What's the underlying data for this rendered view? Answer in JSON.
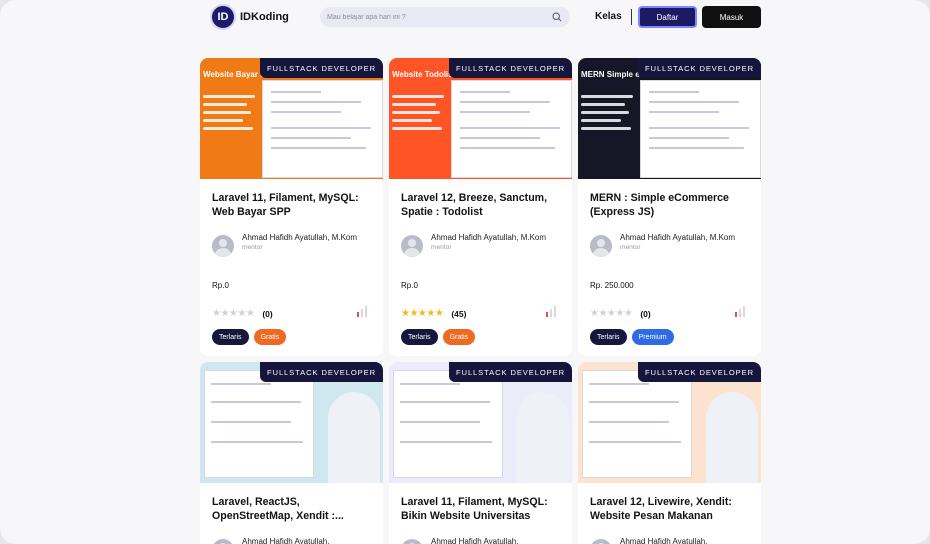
{
  "nav": {
    "brand": "IDKoding",
    "logo_mark": "ID",
    "search_placeholder": "Mau belajar apa hari ini ?",
    "kelas_label": "Kelas",
    "daftar_label": "Daftar",
    "masuk_label": "Masuk"
  },
  "courses": [
    {
      "band": "FULLSTACK DEVELOPER",
      "thumb_title": "Website Bayar SPP",
      "thumb_color": "#f07a15",
      "title": "Laravel 11, Filament, MySQL: Web Bayar SPP",
      "author": "Ahmad Hafidh Ayatullah, M.Kom",
      "role": "mentor",
      "price": "Rp.0",
      "stars": 0,
      "rating_count": "(0)",
      "tags": [
        {
          "label": "Terlaris",
          "style": "dark"
        },
        {
          "label": "Gratis",
          "style": "orange"
        }
      ]
    },
    {
      "band": "FULLSTACK DEVELOPER",
      "thumb_title": "Website Todolist",
      "thumb_color": "#ff5426",
      "title": "Laravel 12, Breeze, Sanctum, Spatie : Todolist",
      "author": "Ahmad Hafidh Ayatullah, M.Kom",
      "role": "mentor",
      "price": "Rp.0",
      "stars": 5,
      "rating_count": "(45)",
      "tags": [
        {
          "label": "Terlaris",
          "style": "dark"
        },
        {
          "label": "Gratis",
          "style": "orange"
        }
      ]
    },
    {
      "band": "FULLSTACK DEVELOPER",
      "thumb_title": "MERN Simple eCommerce",
      "thumb_color": "#161626",
      "title": "MERN : Simple eCommerce (Express JS)",
      "author": "Ahmad Hafidh Ayatullah, M.Kom",
      "role": "mentor",
      "price": "Rp. 250.000",
      "stars": 0,
      "rating_count": "(0)",
      "tags": [
        {
          "label": "Terlaris",
          "style": "dark"
        },
        {
          "label": "Premium",
          "style": "blue"
        }
      ]
    },
    {
      "band": "FULLSTACK DEVELOPER",
      "thumb_title": "",
      "thumb_color": "#cfe8ef",
      "title": "Laravel, ReactJS, OpenStreetMap, Xendit :...",
      "author": "Ahmad Hafidh Ayatullah,",
      "role": "",
      "price": "",
      "stars": 0,
      "rating_count": "",
      "tags": []
    },
    {
      "band": "FULLSTACK DEVELOPER",
      "thumb_title": "",
      "thumb_color": "#ecebfa",
      "title": "Laravel 11, Filament, MySQL: Bikin Website Universitas",
      "author": "Ahmad Hafidh Ayatullah,",
      "role": "",
      "price": "",
      "stars": 0,
      "rating_count": "",
      "tags": []
    },
    {
      "band": "FULLSTACK DEVELOPER",
      "thumb_title": "",
      "thumb_color": "#fbe3cf",
      "title": "Laravel 12, Livewire, Xendit: Website Pesan Makanan",
      "author": "Ahmad Hafidh Ayatullah,",
      "role": "",
      "price": "",
      "stars": 0,
      "rating_count": "",
      "tags": []
    }
  ]
}
